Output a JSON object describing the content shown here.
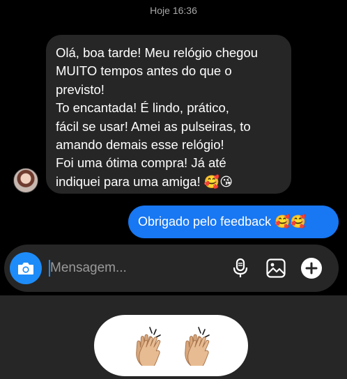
{
  "chat": {
    "timestamp": "Hoje 16:36",
    "incoming": {
      "lines": [
        "Olá, boa tarde! Meu relógio chegou",
        "MUITO tempos antes do que o",
        "previsto!",
        "To encantada! É lindo, prático,",
        "fácil se usar! Amei as pulseiras, to",
        "amando demais esse relógio!",
        "Foi uma ótima compra! Já até",
        "indiquei para uma amiga! "
      ],
      "emojis": "🥰😘"
    },
    "outgoing": {
      "text": "Obrigado pelo feedback ",
      "emojis": "🥰🥰"
    }
  },
  "composer": {
    "placeholder": "Mensagem...",
    "camera_icon": "camera-icon",
    "mic_icon": "microphone-icon",
    "gallery_icon": "image-gallery-icon",
    "add_icon": "plus-circle-icon"
  },
  "reactions": {
    "items": [
      "clapping-hands",
      "clapping-hands"
    ]
  },
  "colors": {
    "background": "#000000",
    "incoming_bubble": "#262626",
    "outgoing_bubble": "#1877f2",
    "accent": "#1d8cf8"
  }
}
